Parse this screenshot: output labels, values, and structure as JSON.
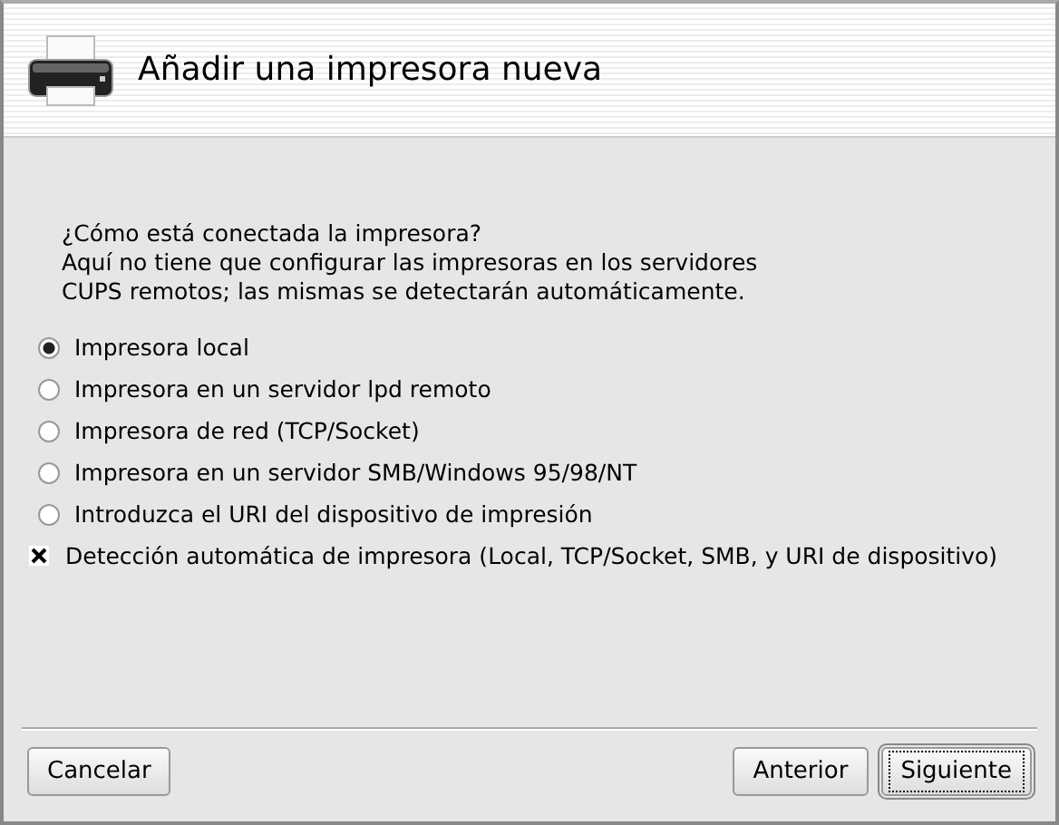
{
  "header": {
    "title": "Añadir una impresora nueva"
  },
  "intro": [
    "¿Cómo está conectada la impresora?",
    "Aquí no tiene que configurar las impresoras en los servidores",
    "CUPS remotos; las mismas se detectarán automáticamente."
  ],
  "options": [
    {
      "label": "Impresora local",
      "selected": true
    },
    {
      "label": "Impresora en un servidor lpd remoto",
      "selected": false
    },
    {
      "label": "Impresora de red (TCP/Socket)",
      "selected": false
    },
    {
      "label": "Impresora en un servidor SMB/Windows 95/98/NT",
      "selected": false
    },
    {
      "label": "Introduzca el URI del dispositivo de impresión",
      "selected": false
    }
  ],
  "autodetect": {
    "label": "Detección automática de impresora (Local, TCP/Socket, SMB, y URI de dispositivo)",
    "checked": true
  },
  "buttons": [
    {
      "label": "Cancelar",
      "focused": false
    },
    {
      "label": "Anterior",
      "focused": false
    },
    {
      "label": "Siguiente",
      "focused": true
    }
  ]
}
